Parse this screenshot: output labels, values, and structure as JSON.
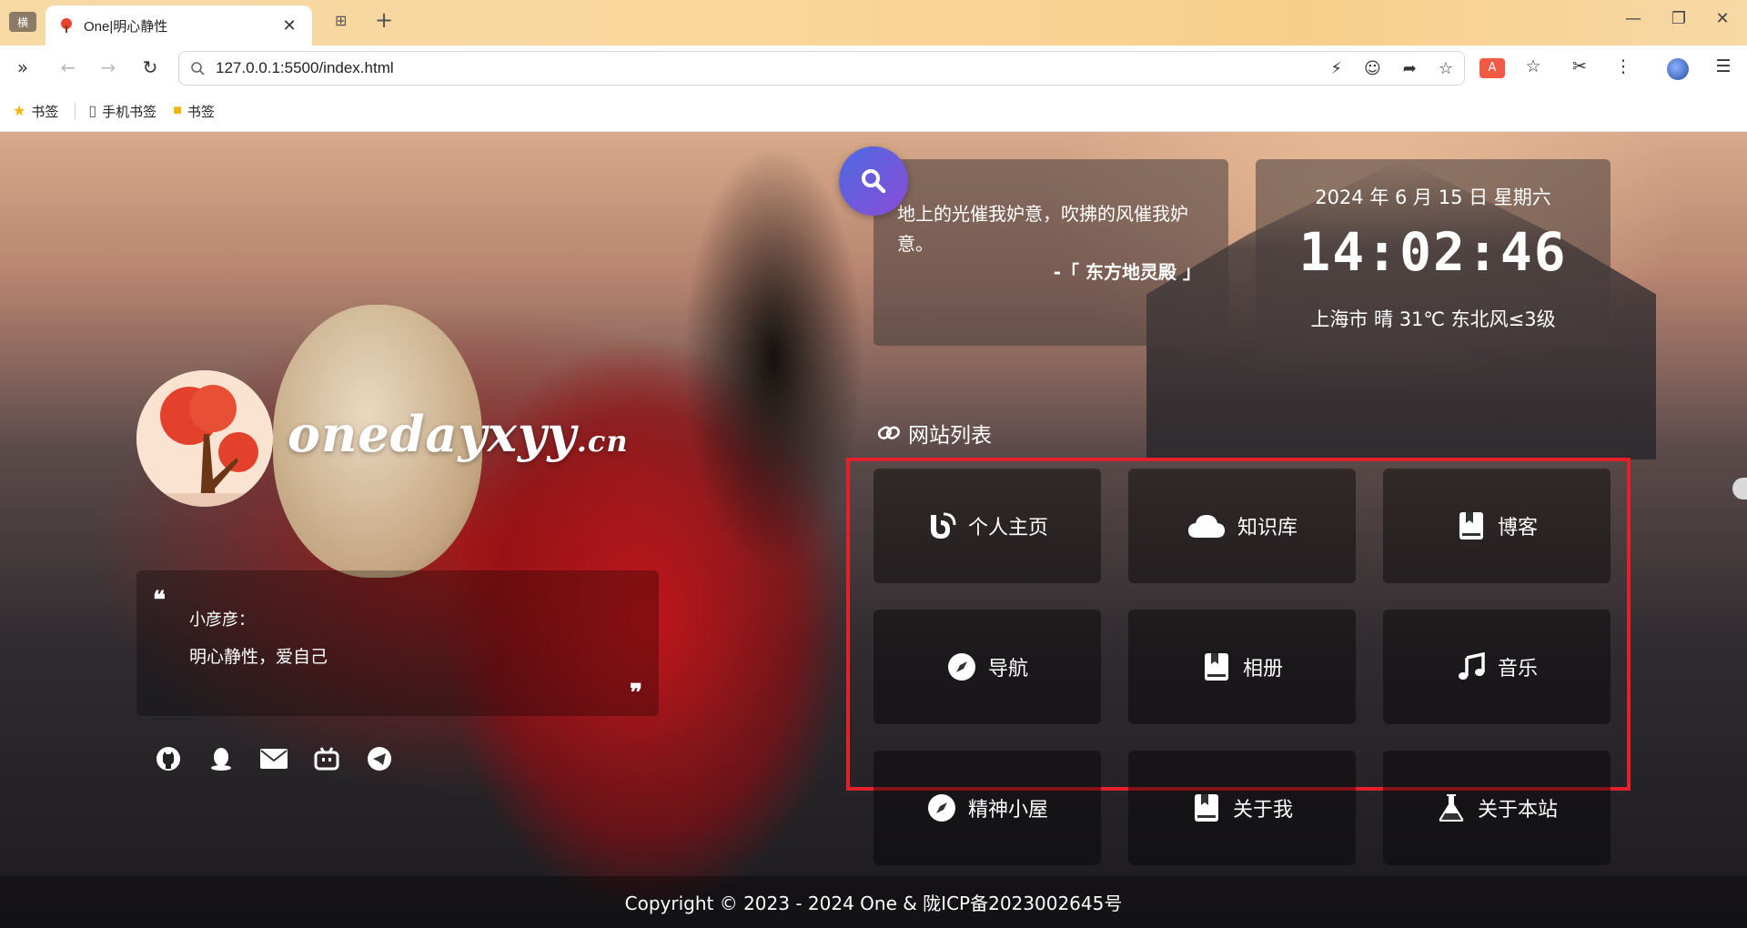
{
  "browser": {
    "tab_menu_label": "横",
    "tab_title": "One|明心静性",
    "url": "127.0.0.1:5500/index.html",
    "bookmarks": [
      {
        "label": "书签"
      },
      {
        "label": "手机书签"
      },
      {
        "label": "书签"
      }
    ]
  },
  "page": {
    "logo": {
      "main": "onedayxyy",
      "suffix": ".cn"
    },
    "quote": {
      "author": "小彦彦：",
      "text": "明心静性，爱自己"
    },
    "hitokoto": {
      "text": "地上的光催我妒意，吹拂的风催我妒意。",
      "from": "-「 东方地灵殿 」"
    },
    "time": {
      "date": "2024 年 6 月 15 日 星期六",
      "clock": "14:02:46",
      "weather": "上海市 晴 31℃ 东北风≤3级"
    },
    "sites_title": "网站列表",
    "sites": [
      {
        "label": "个人主页",
        "icon": "blog-rss-icon"
      },
      {
        "label": "知识库",
        "icon": "cloud-icon"
      },
      {
        "label": "博客",
        "icon": "book-icon"
      },
      {
        "label": "导航",
        "icon": "compass-icon"
      },
      {
        "label": "相册",
        "icon": "book-icon"
      },
      {
        "label": "音乐",
        "icon": "music-note-icon"
      },
      {
        "label": "精神小屋",
        "icon": "compass-icon"
      },
      {
        "label": "关于我",
        "icon": "book-icon"
      },
      {
        "label": "关于本站",
        "icon": "flask-icon"
      }
    ],
    "footer": "Copyright © 2023 - 2024 One &  陇ICP备2023002645号"
  },
  "colors": {
    "highlight": "#e4212b",
    "search_bubble_from": "#4d6be0",
    "search_bubble_to": "#8a4bd8"
  }
}
